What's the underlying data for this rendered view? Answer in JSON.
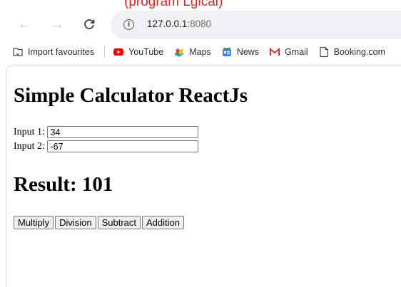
{
  "annotation": "(program Lgical)",
  "browser": {
    "url_host": "127.0.0.1",
    "url_port": ":8080"
  },
  "bookmarks": [
    {
      "label": "Import favourites",
      "icon": "import-icon"
    },
    {
      "label": "YouTube",
      "icon": "youtube-icon"
    },
    {
      "label": "Maps",
      "icon": "maps-icon"
    },
    {
      "label": "News",
      "icon": "news-icon"
    },
    {
      "label": "Gmail",
      "icon": "gmail-icon"
    },
    {
      "label": "Booking.com",
      "icon": "document-icon"
    }
  ],
  "app": {
    "title": "Simple Calculator ReactJs",
    "input1": {
      "label": "Input 1:",
      "value": "34"
    },
    "input2": {
      "label": "Input 2:",
      "value": "-67"
    },
    "result_label": "Result: 101",
    "buttons": [
      "Multiply",
      "Division",
      "Subtract",
      "Addition"
    ]
  },
  "colors": {
    "annotation": "#e8211e",
    "youtube": "#ff0000",
    "gmail": "#d93025"
  }
}
